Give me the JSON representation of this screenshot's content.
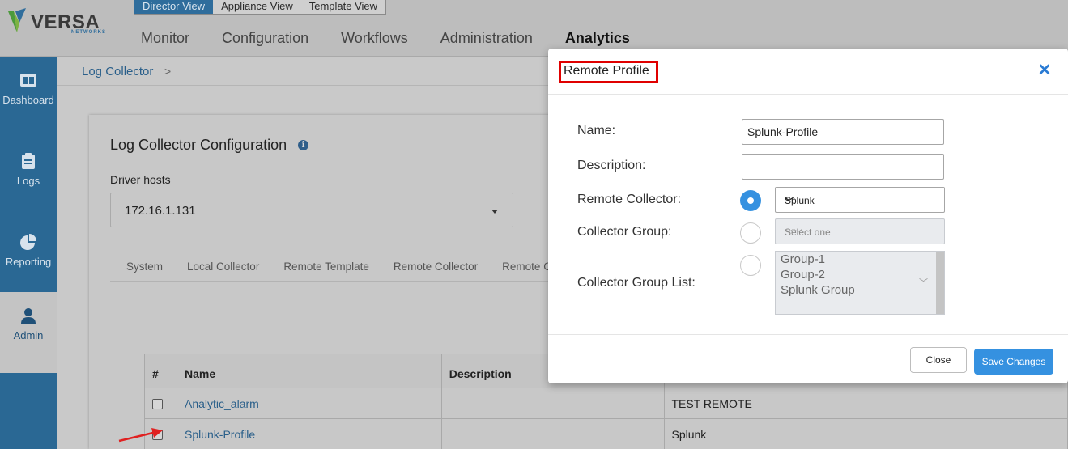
{
  "brand": {
    "name": "VERSA",
    "sub": "NETWORKS"
  },
  "views": [
    "Director View",
    "Appliance View",
    "Template View"
  ],
  "nav": [
    "Monitor",
    "Configuration",
    "Workflows",
    "Administration",
    "Analytics"
  ],
  "sidebar": [
    "Dashboard",
    "Logs",
    "Reporting",
    "Admin"
  ],
  "breadcrumb": {
    "label": "Log Collector",
    "sep": ">"
  },
  "card": {
    "title": "Log Collector Configuration",
    "driver_label": "Driver hosts",
    "driver_value": "172.16.1.131",
    "tabs": [
      "System",
      "Local Collector",
      "Remote Template",
      "Remote Collector",
      "Remote Collec"
    ]
  },
  "table": {
    "headers": [
      "#",
      "Name",
      "Description",
      ""
    ],
    "rows": [
      {
        "name": "Analytic_alarm",
        "description": "",
        "type": "TEST REMOTE"
      },
      {
        "name": "Splunk-Profile",
        "description": "",
        "type": "Splunk"
      }
    ]
  },
  "modal": {
    "title": "Remote Profile",
    "close_icon": "close-icon",
    "name_label": "Name:",
    "name_value": "Splunk-Profile",
    "description_label": "Description:",
    "description_value": "",
    "remote_collector_label": "Remote Collector:",
    "remote_collector_value": "Splunk",
    "collector_group_label": "Collector Group:",
    "collector_group_placeholder": "Select one",
    "collector_group_list_label": "Collector Group List:",
    "collector_group_list": [
      "Group-1",
      "Group-2",
      "Splunk Group"
    ],
    "close_button": "Close",
    "save_button": "Save Changes"
  },
  "colors": {
    "accent": "#3591e0",
    "highlight_box": "#e00000",
    "sidebar": "#2a6894",
    "arrow": "#e02020"
  }
}
